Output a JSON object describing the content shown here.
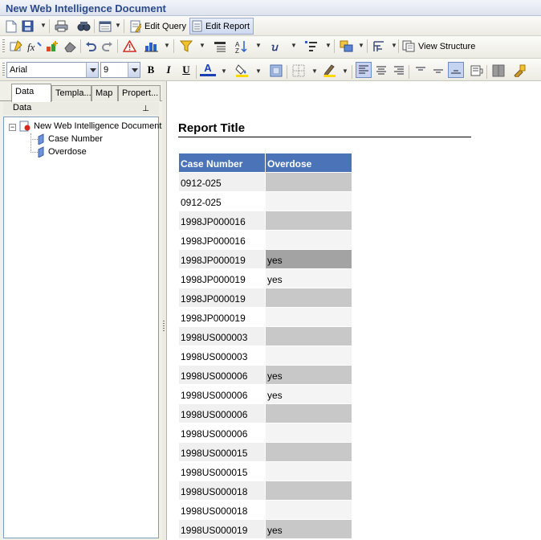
{
  "window": {
    "title": "New Web Intelligence Document"
  },
  "toolbar1": {
    "icons": [
      "new-document-icon",
      "save-icon",
      "print-icon",
      "find-icon",
      "view-mode-icon",
      "edit-query-icon",
      "edit-report-icon"
    ],
    "edit_query_label": "Edit Query",
    "edit_report_label": "Edit Report"
  },
  "toolbar2": {
    "icons": [
      "insert-cell-icon",
      "formula-icon",
      "variable-icon",
      "eraser-icon",
      "undo-icon",
      "redo-icon",
      "alert-icon",
      "chart-icon",
      "filter-icon",
      "break-icon",
      "sort-icon",
      "calculation-icon",
      "ranking-icon",
      "group-icon",
      "tracking-icon",
      "view-structure-icon"
    ],
    "view_structure_label": "View Structure"
  },
  "toolbar3": {
    "font_family": "Arial",
    "font_size": "9",
    "bold_label": "B",
    "italic_label": "I",
    "underline_label": "U",
    "font_color_label": "A",
    "font_color": "#1a3fb5",
    "fill_color": "#ffd800",
    "border_color": "#ffd800"
  },
  "left_panel": {
    "tabs": [
      "Data",
      "Templa...",
      "Map",
      "Propert..."
    ],
    "active_tab": "Data",
    "header_label": "Data",
    "tree": {
      "root": "New Web Intelligence Document",
      "children": [
        "Case Number",
        "Overdose"
      ]
    }
  },
  "report": {
    "title": "Report Title",
    "columns": [
      "Case Number",
      "Overdose"
    ],
    "rows": [
      [
        "0912-025",
        ""
      ],
      [
        "0912-025",
        ""
      ],
      [
        "1998JP000016",
        ""
      ],
      [
        "1998JP000016",
        ""
      ],
      [
        "1998JP000019",
        "yes"
      ],
      [
        "1998JP000019",
        "yes"
      ],
      [
        "1998JP000019",
        ""
      ],
      [
        "1998JP000019",
        ""
      ],
      [
        "1998US000003",
        ""
      ],
      [
        "1998US000003",
        ""
      ],
      [
        "1998US000006",
        "yes"
      ],
      [
        "1998US000006",
        "yes"
      ],
      [
        "1998US000006",
        ""
      ],
      [
        "1998US000006",
        ""
      ],
      [
        "1998US000015",
        ""
      ],
      [
        "1998US000015",
        ""
      ],
      [
        "1998US000018",
        ""
      ],
      [
        "1998US000018",
        ""
      ],
      [
        "1998US000019",
        "yes"
      ]
    ]
  },
  "colors": {
    "header_bg": "#4a73b8",
    "title_color": "#2b4a8b"
  }
}
